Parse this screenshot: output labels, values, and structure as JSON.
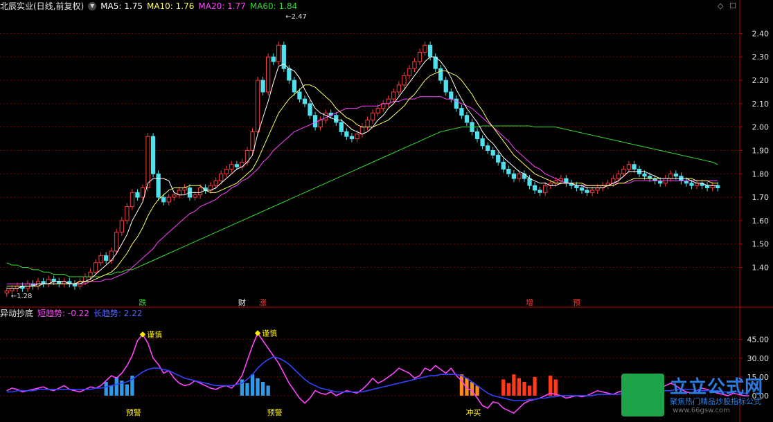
{
  "main_header": {
    "title": "北辰实业(日线,前复权)",
    "ma5": "MA5: 1.75",
    "ma10": "MA10: 1.76",
    "ma20": "MA20: 1.77",
    "ma60": "MA60: 1.84"
  },
  "sub_header": {
    "title": "异动抄底",
    "short": "短趋势: -0.22",
    "long": "长趋势: 2.22"
  },
  "colors": {
    "up": "#ff3b3b",
    "down": "#4fe0ee",
    "ma5": "#ffffff",
    "ma10": "#ffff66",
    "ma20": "#ff44ff",
    "ma60": "#33dd33",
    "short": "#ff44ff",
    "long": "#3344ff",
    "grid": "#7a0000",
    "axis": "#b00000"
  },
  "chart_data": [
    {
      "type": "candlestick",
      "ylim": [
        1.23,
        2.49
      ],
      "y_ticks": [
        "2.40",
        "2.30",
        "2.20",
        "2.10",
        "2.00",
        "1.90",
        "1.80",
        "1.70",
        "1.60",
        "1.50",
        "1.40"
      ],
      "annotations": {
        "high": "2.47",
        "low": "1.28"
      },
      "signals": [
        {
          "index": 26,
          "text": "跌",
          "color": "#33dd33"
        },
        {
          "index": 45,
          "text": "财",
          "color": "#ffffff"
        },
        {
          "index": 49,
          "text": "涨",
          "color": "#ff3b3b"
        },
        {
          "index": 100,
          "text": "增",
          "color": "#ff3b3b"
        },
        {
          "index": 109,
          "text": "预",
          "color": "#ff3b3b"
        }
      ],
      "close": [
        1.3,
        1.31,
        1.32,
        1.31,
        1.33,
        1.32,
        1.34,
        1.33,
        1.35,
        1.34,
        1.33,
        1.34,
        1.33,
        1.32,
        1.34,
        1.36,
        1.38,
        1.42,
        1.45,
        1.43,
        1.47,
        1.55,
        1.6,
        1.66,
        1.72,
        1.7,
        1.74,
        1.96,
        1.8,
        1.7,
        1.68,
        1.7,
        1.71,
        1.73,
        1.74,
        1.7,
        1.71,
        1.74,
        1.73,
        1.75,
        1.77,
        1.8,
        1.82,
        1.84,
        1.83,
        1.85,
        1.9,
        1.98,
        2.2,
        2.15,
        2.3,
        2.28,
        2.35,
        2.25,
        2.2,
        2.15,
        2.12,
        2.1,
        2.05,
        2.0,
        2.03,
        2.06,
        2.05,
        2.02,
        1.98,
        1.96,
        1.95,
        1.97,
        2.0,
        2.03,
        2.06,
        2.08,
        2.1,
        2.12,
        2.15,
        2.18,
        2.22,
        2.25,
        2.28,
        2.32,
        2.35,
        2.3,
        2.25,
        2.2,
        2.15,
        2.12,
        2.08,
        2.05,
        2.02,
        1.98,
        1.95,
        1.92,
        1.9,
        1.88,
        1.85,
        1.82,
        1.8,
        1.78,
        1.8,
        1.78,
        1.75,
        1.73,
        1.72,
        1.75,
        1.76,
        1.77,
        1.78,
        1.76,
        1.75,
        1.74,
        1.73,
        1.72,
        1.73,
        1.74,
        1.75,
        1.76,
        1.78,
        1.8,
        1.82,
        1.84,
        1.82,
        1.8,
        1.79,
        1.78,
        1.77,
        1.76,
        1.78,
        1.8,
        1.79,
        1.77,
        1.76,
        1.75,
        1.76,
        1.75,
        1.74,
        1.75,
        1.74
      ],
      "ma5": [
        1.31,
        1.31,
        1.31,
        1.32,
        1.32,
        1.32,
        1.33,
        1.33,
        1.33,
        1.34,
        1.34,
        1.34,
        1.33,
        1.33,
        1.33,
        1.34,
        1.35,
        1.37,
        1.39,
        1.41,
        1.43,
        1.46,
        1.5,
        1.54,
        1.6,
        1.64,
        1.68,
        1.76,
        1.78,
        1.78,
        1.78,
        1.77,
        1.72,
        1.71,
        1.71,
        1.72,
        1.72,
        1.72,
        1.73,
        1.73,
        1.74,
        1.76,
        1.78,
        1.8,
        1.82,
        1.83,
        1.85,
        1.88,
        1.97,
        2.04,
        2.11,
        2.19,
        2.26,
        2.27,
        2.25,
        2.24,
        2.21,
        2.16,
        2.12,
        2.08,
        2.06,
        2.05,
        2.04,
        2.03,
        2.03,
        2.01,
        1.99,
        1.98,
        1.97,
        1.98,
        2.0,
        2.03,
        2.05,
        2.08,
        2.1,
        2.13,
        2.16,
        2.19,
        2.22,
        2.25,
        2.28,
        2.3,
        2.3,
        2.28,
        2.25,
        2.21,
        2.16,
        2.12,
        2.08,
        2.05,
        2.02,
        1.98,
        1.95,
        1.93,
        1.9,
        1.87,
        1.85,
        1.83,
        1.81,
        1.8,
        1.78,
        1.77,
        1.76,
        1.76,
        1.75,
        1.75,
        1.76,
        1.76,
        1.76,
        1.75,
        1.75,
        1.74,
        1.74,
        1.74,
        1.74,
        1.75,
        1.76,
        1.77,
        1.79,
        1.81,
        1.81,
        1.81,
        1.81,
        1.8,
        1.79,
        1.78,
        1.78,
        1.78,
        1.78,
        1.78,
        1.78,
        1.77,
        1.76,
        1.76,
        1.75,
        1.75,
        1.75
      ],
      "ma10": [
        1.32,
        1.32,
        1.32,
        1.32,
        1.32,
        1.32,
        1.32,
        1.33,
        1.33,
        1.33,
        1.33,
        1.33,
        1.33,
        1.33,
        1.34,
        1.34,
        1.34,
        1.35,
        1.36,
        1.37,
        1.38,
        1.4,
        1.43,
        1.46,
        1.5,
        1.53,
        1.57,
        1.62,
        1.66,
        1.69,
        1.71,
        1.73,
        1.74,
        1.74,
        1.74,
        1.75,
        1.75,
        1.75,
        1.73,
        1.72,
        1.72,
        1.73,
        1.74,
        1.75,
        1.76,
        1.78,
        1.8,
        1.82,
        1.86,
        1.91,
        1.96,
        2.01,
        2.06,
        2.09,
        2.12,
        2.14,
        2.16,
        2.18,
        2.18,
        2.17,
        2.15,
        2.13,
        2.11,
        2.08,
        2.06,
        2.04,
        2.03,
        2.01,
        2.0,
        2.0,
        2.0,
        2.01,
        2.02,
        2.03,
        2.05,
        2.07,
        2.09,
        2.12,
        2.14,
        2.17,
        2.2,
        2.22,
        2.23,
        2.24,
        2.24,
        2.23,
        2.22,
        2.2,
        2.17,
        2.14,
        2.1,
        2.07,
        2.03,
        2.0,
        1.97,
        1.94,
        1.91,
        1.88,
        1.86,
        1.84,
        1.82,
        1.8,
        1.79,
        1.78,
        1.77,
        1.76,
        1.76,
        1.76,
        1.76,
        1.76,
        1.76,
        1.75,
        1.75,
        1.75,
        1.75,
        1.75,
        1.75,
        1.76,
        1.76,
        1.77,
        1.78,
        1.78,
        1.78,
        1.78,
        1.78,
        1.78,
        1.78,
        1.78,
        1.78,
        1.78,
        1.78,
        1.78,
        1.77,
        1.77,
        1.77,
        1.76,
        1.76
      ],
      "ma20": [
        1.33,
        1.33,
        1.33,
        1.33,
        1.33,
        1.33,
        1.33,
        1.33,
        1.33,
        1.33,
        1.33,
        1.33,
        1.33,
        1.33,
        1.33,
        1.33,
        1.34,
        1.34,
        1.34,
        1.35,
        1.35,
        1.36,
        1.37,
        1.38,
        1.4,
        1.42,
        1.44,
        1.46,
        1.48,
        1.51,
        1.53,
        1.55,
        1.57,
        1.59,
        1.61,
        1.63,
        1.64,
        1.66,
        1.67,
        1.68,
        1.69,
        1.71,
        1.72,
        1.74,
        1.75,
        1.77,
        1.78,
        1.8,
        1.82,
        1.85,
        1.87,
        1.9,
        1.92,
        1.94,
        1.96,
        1.98,
        1.99,
        2.0,
        2.01,
        2.02,
        2.03,
        2.04,
        2.05,
        2.06,
        2.07,
        2.08,
        2.08,
        2.08,
        2.09,
        2.09,
        2.09,
        2.09,
        2.1,
        2.1,
        2.11,
        2.11,
        2.12,
        2.12,
        2.12,
        2.13,
        2.13,
        2.13,
        2.13,
        2.13,
        2.12,
        2.12,
        2.11,
        2.1,
        2.09,
        2.08,
        2.06,
        2.04,
        2.02,
        2.0,
        1.98,
        1.96,
        1.94,
        1.91,
        1.89,
        1.87,
        1.85,
        1.83,
        1.82,
        1.8,
        1.79,
        1.78,
        1.77,
        1.76,
        1.76,
        1.75,
        1.75,
        1.75,
        1.75,
        1.75,
        1.75,
        1.75,
        1.76,
        1.76,
        1.76,
        1.76,
        1.77,
        1.77,
        1.77,
        1.77,
        1.77,
        1.77,
        1.77,
        1.77,
        1.77,
        1.77,
        1.77,
        1.77,
        1.77,
        1.77,
        1.77,
        1.77,
        1.77
      ],
      "ma60": [
        1.42,
        1.41,
        1.41,
        1.4,
        1.4,
        1.39,
        1.39,
        1.38,
        1.38,
        1.37,
        1.37,
        1.37,
        1.36,
        1.36,
        1.36,
        1.36,
        1.36,
        1.36,
        1.36,
        1.37,
        1.37,
        1.38,
        1.38,
        1.39,
        1.39,
        1.4,
        1.41,
        1.42,
        1.43,
        1.44,
        1.45,
        1.46,
        1.47,
        1.48,
        1.49,
        1.5,
        1.51,
        1.52,
        1.53,
        1.54,
        1.55,
        1.56,
        1.57,
        1.58,
        1.59,
        1.6,
        1.61,
        1.62,
        1.63,
        1.64,
        1.65,
        1.66,
        1.67,
        1.68,
        1.69,
        1.7,
        1.71,
        1.72,
        1.73,
        1.74,
        1.75,
        1.76,
        1.77,
        1.78,
        1.79,
        1.8,
        1.81,
        1.82,
        1.83,
        1.84,
        1.85,
        1.86,
        1.87,
        1.88,
        1.89,
        1.9,
        1.91,
        1.92,
        1.93,
        1.94,
        1.95,
        1.96,
        1.97,
        1.98,
        1.985,
        1.99,
        1.995,
        2.0,
        2.0,
        2.0,
        2.0,
        2.005,
        2.005,
        2.005,
        2.005,
        2.005,
        2.005,
        2.005,
        2.005,
        2.005,
        2.005,
        2.0,
        2.0,
        2.0,
        2.0,
        2.0,
        1.995,
        1.99,
        1.985,
        1.98,
        1.975,
        1.97,
        1.965,
        1.96,
        1.955,
        1.95,
        1.945,
        1.94,
        1.935,
        1.93,
        1.925,
        1.92,
        1.915,
        1.91,
        1.905,
        1.9,
        1.895,
        1.89,
        1.885,
        1.88,
        1.875,
        1.87,
        1.865,
        1.86,
        1.855,
        1.85,
        1.84
      ]
    },
    {
      "type": "line",
      "ylim": [
        -20,
        62
      ],
      "y_ticks": [
        "45.00",
        "30.00",
        "15.00",
        "0.00"
      ],
      "series": [
        {
          "name": "短趋势",
          "values": [
            4,
            6,
            5,
            3,
            4,
            5,
            6,
            7,
            5,
            4,
            6,
            8,
            5,
            4,
            3,
            5,
            7,
            6,
            8,
            12,
            16,
            14,
            18,
            24,
            32,
            44,
            49,
            42,
            30,
            25,
            18,
            20,
            14,
            10,
            8,
            9,
            12,
            10,
            8,
            6,
            5,
            7,
            8,
            6,
            10,
            16,
            28,
            40,
            50,
            44,
            38,
            32,
            26,
            18,
            10,
            4,
            -2,
            -6,
            -2,
            4,
            2,
            1,
            3,
            0,
            2,
            4,
            3,
            2,
            5,
            9,
            14,
            10,
            12,
            15,
            18,
            22,
            20,
            18,
            14,
            16,
            22,
            20,
            24,
            21,
            18,
            22,
            16,
            12,
            6,
            4,
            -2,
            -8,
            -10,
            -5,
            -6,
            -10,
            -12,
            -14,
            -10,
            -6,
            -4,
            -3,
            -2,
            0,
            2,
            1,
            0,
            -2,
            -1,
            0,
            -1,
            0,
            2,
            4,
            3,
            2,
            1,
            3,
            4,
            2,
            1,
            0,
            2,
            3,
            5,
            6,
            8,
            10,
            8,
            5,
            3,
            2,
            4,
            6,
            5,
            3,
            2,
            1,
            0,
            2,
            1,
            0,
            -0.22
          ]
        },
        {
          "name": "长趋势",
          "values": [
            3,
            3,
            4,
            4,
            4,
            4,
            5,
            5,
            5,
            5,
            5,
            5,
            5,
            5,
            5,
            5,
            5,
            6,
            6,
            7,
            8,
            9,
            10,
            11,
            13,
            16,
            19,
            21,
            22,
            22,
            21,
            20,
            18,
            16,
            14,
            13,
            12,
            11,
            10,
            9,
            8,
            8,
            8,
            8,
            9,
            10,
            13,
            17,
            22,
            26,
            29,
            31,
            30,
            28,
            25,
            21,
            17,
            13,
            10,
            8,
            6,
            5,
            4,
            3,
            3,
            3,
            3,
            3,
            3,
            4,
            5,
            6,
            7,
            8,
            9,
            10,
            11,
            12,
            13,
            14,
            15,
            16,
            16,
            17,
            17,
            17,
            17,
            16,
            14,
            11,
            8,
            5,
            2,
            0,
            -1,
            -2,
            -3,
            -4,
            -4,
            -4,
            -3,
            -3,
            -2,
            -2,
            -1,
            -1,
            0,
            0,
            0,
            0,
            0,
            0,
            0,
            1,
            1,
            1,
            1,
            1,
            2,
            2,
            2,
            2,
            2,
            3,
            3,
            3,
            4,
            4,
            5,
            5,
            5,
            5,
            4,
            4,
            4,
            4,
            4,
            3,
            3,
            3,
            3,
            2,
            2.22
          ]
        }
      ],
      "labels": [
        {
          "index": 26,
          "text": "谨慎"
        },
        {
          "index": 48,
          "text": "谨慎"
        },
        {
          "index": 22,
          "text": "预警"
        },
        {
          "index": 49,
          "text": "预警"
        },
        {
          "index": 87,
          "text": "冲买"
        }
      ]
    }
  ],
  "watermark": {
    "title": "立立公式网",
    "subtitle": "聚焦热门精品炒股指标公式",
    "url": "www.66gsw.com"
  }
}
